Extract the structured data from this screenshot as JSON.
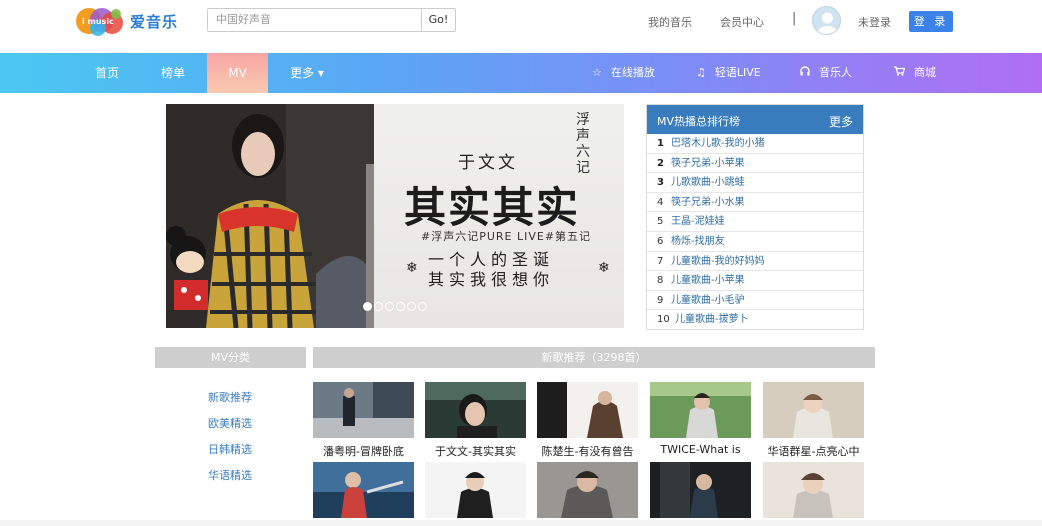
{
  "header": {
    "logo_brand": "爱音乐",
    "logo_icon_text": "i music",
    "search_placeholder": "中国好声音",
    "search_button": "Go!",
    "links": {
      "my_music": "我的音乐",
      "vip_center": "会员中心"
    },
    "separator": "|",
    "user_status": "未登录",
    "login_button": "登 录"
  },
  "nav": {
    "items": [
      {
        "label": "首页",
        "active": false
      },
      {
        "label": "榜单",
        "active": false
      },
      {
        "label": "MV",
        "active": true
      },
      {
        "label": "更多 ▾",
        "active": false
      }
    ],
    "right": [
      {
        "icon": "star-icon",
        "glyph": "☆",
        "label": "在线播放"
      },
      {
        "icon": "music-note-icon",
        "glyph": "♫",
        "label": "轻语LIVE"
      },
      {
        "icon": "headphones-icon",
        "glyph": "🎧",
        "label": "音乐人"
      },
      {
        "icon": "cart-icon",
        "glyph": "🛒",
        "label": "商城"
      }
    ],
    "colors": {
      "start": "#4bc8f1",
      "end": "#b06ef4",
      "active": "#f7a6a4"
    }
  },
  "banner": {
    "artist": "于文文",
    "title": "其实其实",
    "tag": "#浮声六记PURE LIVE#第五记",
    "line1": "一个人的圣诞",
    "line2": "其实我很想你",
    "star_glyph": "❄",
    "stamp": "浮声六记",
    "dots": 6,
    "active_dot": 0
  },
  "ranking": {
    "title": "MV热播总排行榜",
    "more": "更多",
    "items": [
      {
        "rank": "1",
        "name": "巴塔木儿歌-我的小猪"
      },
      {
        "rank": "2",
        "name": "筷子兄弟-小苹果"
      },
      {
        "rank": "3",
        "name": "儿歌歌曲-小跳蛙"
      },
      {
        "rank": "4",
        "name": "筷子兄弟-小水果"
      },
      {
        "rank": "5",
        "name": "王晶-泥娃娃"
      },
      {
        "rank": "6",
        "name": "杨烁-找朋友"
      },
      {
        "rank": "7",
        "name": "儿童歌曲-我的好妈妈"
      },
      {
        "rank": "8",
        "name": "儿童歌曲-小苹果"
      },
      {
        "rank": "9",
        "name": "儿童歌曲-小毛驴"
      },
      {
        "rank": "10",
        "name": "儿童歌曲-拔萝卜"
      }
    ]
  },
  "categories": {
    "title": "MV分类",
    "items": [
      "新歌推荐",
      "欧美精选",
      "日韩精选",
      "华语精选"
    ]
  },
  "recommend": {
    "title": "新歌推荐（3298首）",
    "row1": [
      {
        "caption": "潘粤明-冒牌卧底"
      },
      {
        "caption": "于文文-其实其实"
      },
      {
        "caption": "陈楚生-有没有曾告"
      },
      {
        "caption": "TWICE-What is"
      },
      {
        "caption": "华语群星-点亮心中"
      }
    ],
    "row2_count": 5
  }
}
